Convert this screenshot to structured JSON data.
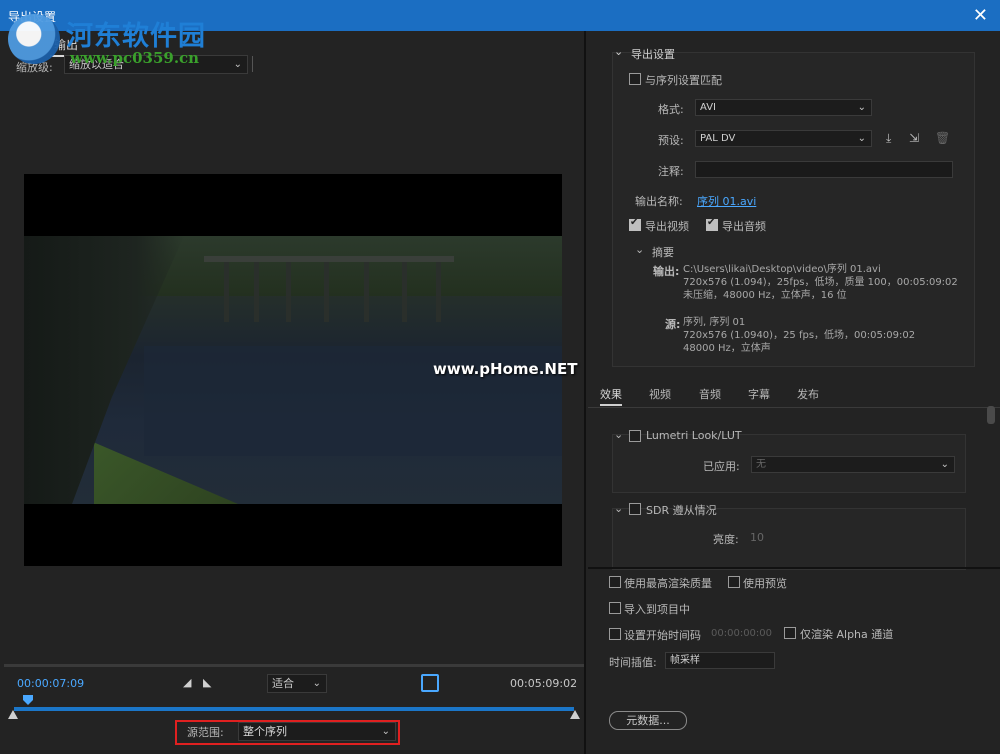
{
  "window": {
    "title": "导出设置",
    "close": "✕"
  },
  "watermark": {
    "site_name": "河东软件园",
    "site_url": "www.pc0359.cn",
    "overlay": "www.pHome.NET"
  },
  "left": {
    "tab_output": "输出",
    "scale_label": "缩放级:",
    "scale_value": "缩放以适合",
    "timecode_current": "00:00:07:09",
    "timecode_end": "00:05:09:02",
    "fit_value": "适合",
    "range_label": "源范围:",
    "range_value": "整个序列"
  },
  "export": {
    "section_title": "导出设置",
    "match_sequence": "与序列设置匹配",
    "format_label": "格式:",
    "format_value": "AVI",
    "preset_label": "预设:",
    "preset_value": "PAL DV",
    "comment_label": "注释:",
    "output_name_label": "输出名称:",
    "output_name_value": "序列 01.avi",
    "export_video": "导出视频",
    "export_audio": "导出音频",
    "summary_title": "摘要",
    "output_label": "输出:",
    "output_lines": [
      "C:\\Users\\likai\\Desktop\\video\\序列 01.avi",
      "720x576 (1.094)，25fps，低场，质量 100，00:05:09:02",
      "未压缩，48000 Hz，立体声，16 位"
    ],
    "source_label": "源:",
    "source_lines": [
      "序列, 序列 01",
      "720x576 (1.0940)，25 fps，低场，00:05:09:02",
      "48000 Hz，立体声"
    ]
  },
  "tabs": [
    "效果",
    "视频",
    "音频",
    "字幕",
    "发布"
  ],
  "effects": {
    "lumetri_title": "Lumetri Look/LUT",
    "applied_label": "已应用:",
    "applied_value": "无",
    "sdr_title": "SDR 遵从情况",
    "brightness_label": "亮度:",
    "brightness_value": "10"
  },
  "options": {
    "max_render": "使用最高渲染质量",
    "use_preview": "使用预览",
    "import_project": "导入到项目中",
    "set_start_tc": "设置开始时间码",
    "start_tc_value": "00:00:00:00",
    "alpha_only": "仅渲染 Alpha 通道",
    "interp_label": "时间插值:",
    "interp_value": "帧采样",
    "metadata_btn": "元数据..."
  }
}
